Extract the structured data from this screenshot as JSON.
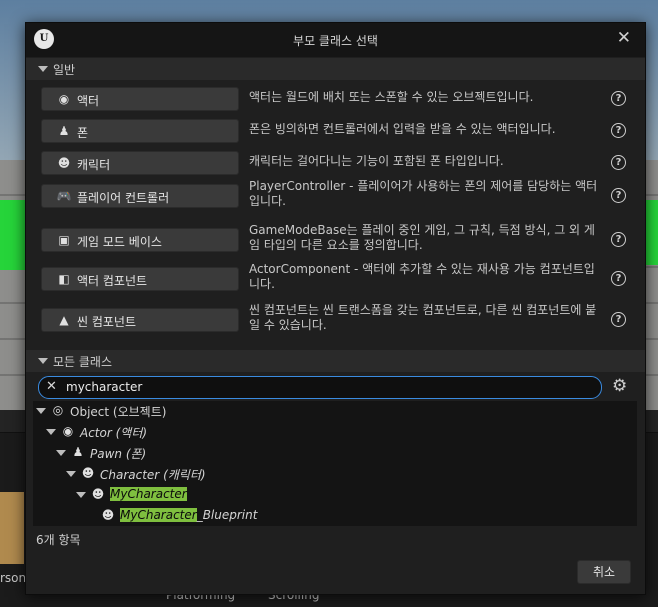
{
  "background": {
    "left_text": "rson",
    "bottom_text_1": "Platforming",
    "bottom_text_2": "Scrolling"
  },
  "dialog": {
    "title": "부모 클래스 선택",
    "common_section": "일반",
    "all_classes_section": "모든 클래스",
    "common_classes": [
      {
        "icon": "actor-icon",
        "glyph": "◉",
        "label": "액터",
        "description": "액터는 월드에 배치 또는 스폰할 수 있는 오브젝트입니다."
      },
      {
        "icon": "pawn-icon",
        "glyph": "♟",
        "label": "폰",
        "description": "폰은 빙의하면 컨트롤러에서 입력을 받을 수 있는 액터입니다."
      },
      {
        "icon": "character-icon",
        "glyph": "☻",
        "label": "캐릭터",
        "description": "캐릭터는 걸어다니는 기능이 포함된 폰 타입입니다."
      },
      {
        "icon": "gamepad-icon",
        "glyph": "🎮",
        "label": "플레이어 컨트롤러",
        "description": "PlayerController - 플레이어가 사용하는 폰의 제어를 담당하는 액터입니다."
      },
      {
        "icon": "game-mode-icon",
        "glyph": "▣",
        "label": "게임 모드 베이스",
        "description": "GameModeBase는 플레이 중인 게임, 그 규칙, 득점 방식, 그 외 게임 타입의 다른 요소를 정의합니다."
      },
      {
        "icon": "actor-component-icon",
        "glyph": "◧",
        "label": "액터 컴포넌트",
        "description": "ActorComponent - 액터에 추가할 수 있는 재사용 가능 컴포넌트입니다."
      },
      {
        "icon": "scene-component-icon",
        "glyph": "▲",
        "label": "씬 컴포넌트",
        "description": "씬 컴포넌트는 씬 트랜스폼을 갖는 컴포넌트로, 다른 씬 컴포넌트에 붙일 수 있습니다."
      }
    ],
    "search": {
      "value": "mycharacter",
      "placeholder": ""
    },
    "tree": [
      {
        "name": "Object",
        "suffix": " (오브젝트)",
        "italic": false,
        "highlight": false,
        "icon": "object-icon"
      },
      {
        "name": "Actor",
        "suffix": " (액터)",
        "italic": true,
        "highlight": false,
        "icon": "actor-icon"
      },
      {
        "name": "Pawn",
        "suffix": " (폰)",
        "italic": true,
        "highlight": false,
        "icon": "pawn-icon"
      },
      {
        "name": "Character",
        "suffix": " (캐릭터)",
        "italic": true,
        "highlight": false,
        "icon": "character-icon"
      },
      {
        "name": "MyCharacter",
        "suffix": "",
        "italic": true,
        "highlight": true,
        "icon": "character-icon"
      },
      {
        "name": "MyCharacter",
        "suffix": "_Blueprint",
        "italic": true,
        "highlight": true,
        "icon": "character-icon"
      }
    ],
    "item_count": "6개 항목",
    "cancel_label": "취소"
  }
}
